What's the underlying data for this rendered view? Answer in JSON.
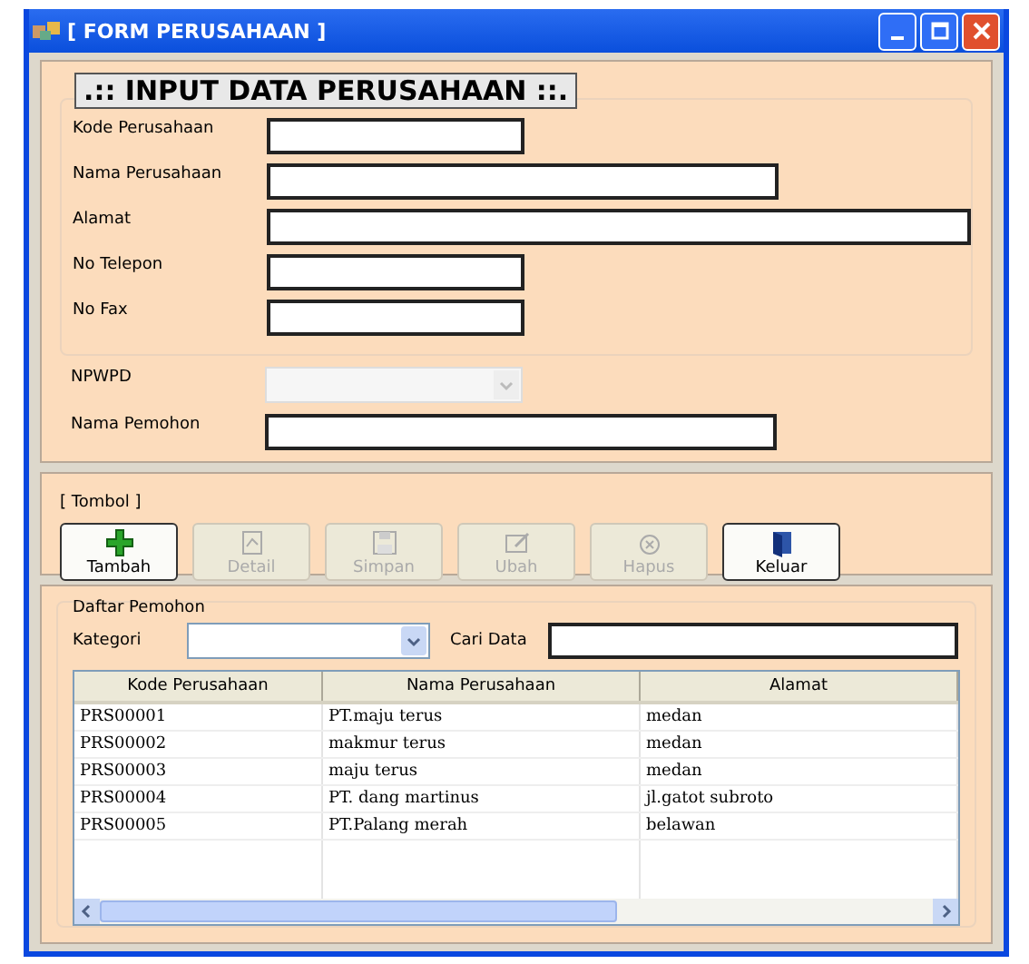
{
  "window": {
    "title": "[ FORM PERUSAHAAN ]"
  },
  "form": {
    "heading": ".:: INPUT DATA PERUSAHAAN ::.",
    "fields": [
      {
        "label": "Kode Perusahaan",
        "kind": "text"
      },
      {
        "label": "Nama Perusahaan",
        "kind": "text"
      },
      {
        "label": "Alamat",
        "kind": "text"
      },
      {
        "label": "No Telepon",
        "kind": "text"
      },
      {
        "label": "No Fax",
        "kind": "text"
      }
    ],
    "extra_fields": [
      {
        "label": "NPWPD",
        "kind": "combo",
        "disabled": true
      },
      {
        "label": "Nama Pemohon",
        "kind": "text",
        "disabled": false
      }
    ]
  },
  "toolbar": {
    "title": "[ Tombol ]",
    "buttons": [
      {
        "label": "Tambah",
        "disabled": false
      },
      {
        "label": "Detail",
        "disabled": true
      },
      {
        "label": "Simpan",
        "disabled": true
      },
      {
        "label": "Ubah",
        "disabled": true
      },
      {
        "label": "Hapus",
        "disabled": true
      },
      {
        "label": "Keluar",
        "disabled": false
      }
    ]
  },
  "list": {
    "title": "Daftar Pemohon",
    "filter_label": "Kategori",
    "search_label": "Cari Data",
    "table": {
      "columns": [
        "Kode Perusahaan",
        "Nama Perusahaan",
        "Alamat"
      ],
      "rows": [
        [
          "PRS00001",
          "PT.maju terus",
          "medan"
        ],
        [
          "PRS00002",
          "makmur terus",
          "medan"
        ],
        [
          "PRS00003",
          "maju terus",
          "medan"
        ],
        [
          "PRS00004",
          "PT. dang martinus",
          "jl.gatot subroto"
        ],
        [
          "PRS00005",
          "PT.Palang merah",
          "belawan"
        ]
      ]
    }
  }
}
